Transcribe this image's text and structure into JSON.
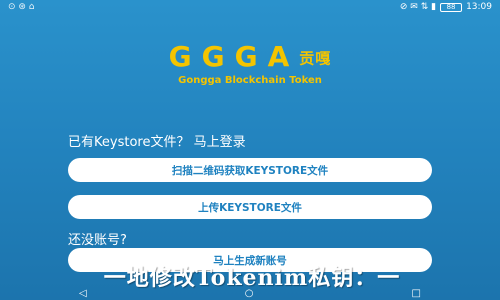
{
  "status": {
    "left_icons": "⊙ ⊛ ⌂",
    "right_icons": "⊘ ✉ ⇅ ▮",
    "battery": "88",
    "time": "13:09"
  },
  "logo": {
    "title": "GGGA",
    "title_cn": "贡嘎",
    "subtitle": "Gongga Blockchain Token"
  },
  "keystore_prompt": "已有Keystore文件？ 马上登录",
  "scan_button": "扫描二维码获取KEYSTORE文件",
  "upload_button": "上传KEYSTORE文件",
  "no_account_prompt": "还没账号?",
  "generate_button": "马上生成新账号",
  "banner_text": "一地修改Tokenim私钥：一",
  "nav": {
    "back": "◁",
    "home": "○",
    "recent": "□"
  },
  "colors": {
    "accent": "#f4c400",
    "background": "#2384bf",
    "button_text": "#1f82c0"
  }
}
